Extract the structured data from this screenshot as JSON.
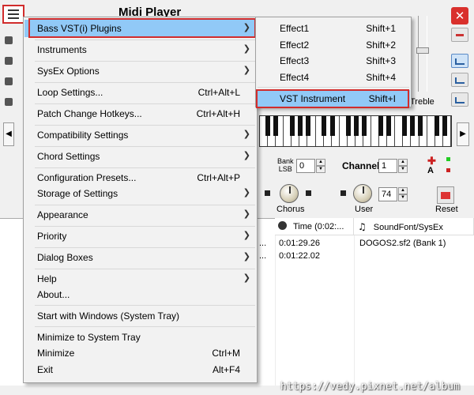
{
  "app": {
    "title": "Midi Player",
    "treble_label": "Treble",
    "bank_label_line1": "Bank",
    "bank_label_line2": "LSB",
    "bank_value": "0",
    "channel_label": "Channel",
    "channel_value": "1",
    "knob_chorus_label": "Chorus",
    "knob_user_label": "User",
    "user_value": "74",
    "reset_label": "Reset",
    "rec_label": "A"
  },
  "table": {
    "col_time_header": "Time (0:02:...",
    "col_soundfont_header": "SoundFont/SysEx",
    "rows": [
      {
        "ellipsis": "...",
        "time": "0:01:29.26",
        "soundfont": "DOGOS2.sf2 (Bank 1)"
      },
      {
        "ellipsis": "...",
        "time": "0:01:22.02",
        "soundfont": ""
      }
    ]
  },
  "main_menu": {
    "items": [
      {
        "label": "Bass VST(i) Plugins",
        "shortcut": "",
        "submenu": true
      },
      {
        "label": "Instruments",
        "shortcut": "",
        "submenu": true
      },
      {
        "label": "SysEx Options",
        "shortcut": "",
        "submenu": true
      },
      {
        "label": "Loop Settings...",
        "shortcut": "Ctrl+Alt+L",
        "submenu": false
      },
      {
        "label": "Patch Change Hotkeys...",
        "shortcut": "Ctrl+Alt+H",
        "submenu": false
      },
      {
        "label": "Compatibility Settings",
        "shortcut": "",
        "submenu": true
      },
      {
        "label": "Chord Settings",
        "shortcut": "",
        "submenu": true
      },
      {
        "label": "Configuration Presets...",
        "shortcut": "Ctrl+Alt+P",
        "submenu": false
      },
      {
        "label": "Storage of Settings",
        "shortcut": "",
        "submenu": true
      },
      {
        "label": "Appearance",
        "shortcut": "",
        "submenu": true
      },
      {
        "label": "Priority",
        "shortcut": "",
        "submenu": true
      },
      {
        "label": "Dialog Boxes",
        "shortcut": "",
        "submenu": true
      },
      {
        "label": "Help",
        "shortcut": "",
        "submenu": true
      },
      {
        "label": "About...",
        "shortcut": "",
        "submenu": false
      },
      {
        "label": "Start with Windows (System Tray)",
        "shortcut": "",
        "submenu": false
      },
      {
        "label": "Minimize to System Tray",
        "shortcut": "",
        "submenu": false
      },
      {
        "label": "Minimize",
        "shortcut": "Ctrl+M",
        "submenu": false
      },
      {
        "label": "Exit",
        "shortcut": "Alt+F4",
        "submenu": false
      }
    ]
  },
  "sub_menu": {
    "items": [
      {
        "label": "Effect1",
        "shortcut": "Shift+1"
      },
      {
        "label": "Effect2",
        "shortcut": "Shift+2"
      },
      {
        "label": "Effect3",
        "shortcut": "Shift+3"
      },
      {
        "label": "Effect4",
        "shortcut": "Shift+4"
      },
      {
        "label": "VST Instrument",
        "shortcut": "Shift+I"
      }
    ]
  },
  "watermark": "https://vedy.pixnet.net/album",
  "colors": {
    "menu_selection": "#91c9f7",
    "highlight_border": "#d12c2c",
    "close_button": "#d9302c"
  },
  "icons": {
    "menu_button": "hamburger-icon",
    "close": "close-icon",
    "submenu_arrow": "chevron-right-icon",
    "time_column": "clock-icon",
    "soundfont_column": "music-note-icon"
  }
}
